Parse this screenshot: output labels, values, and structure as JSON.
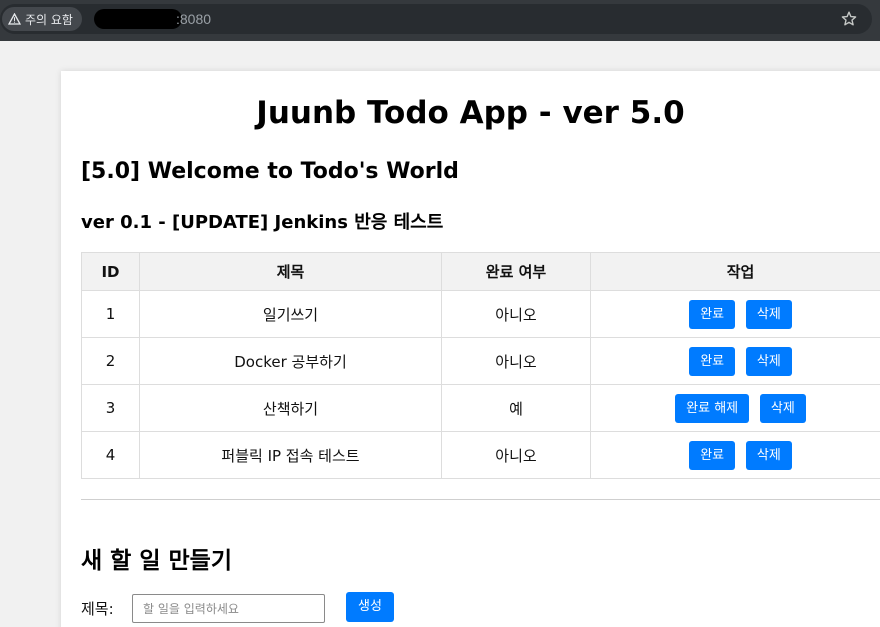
{
  "browser": {
    "security_label": "주의 요함",
    "url_visible": ":8080"
  },
  "page": {
    "app_title": "Juunb Todo App - ver 5.0",
    "welcome": "[5.0] Welcome to Todo's World",
    "version_note": "ver 0.1 - [UPDATE] Jenkins 반응 테스트"
  },
  "table": {
    "headers": [
      "ID",
      "제목",
      "완료 여부",
      "작업"
    ],
    "rows": [
      {
        "id": "1",
        "title": "일기쓰기",
        "done": "아니오",
        "toggle": "완료",
        "delete": "삭제"
      },
      {
        "id": "2",
        "title": "Docker 공부하기",
        "done": "아니오",
        "toggle": "완료",
        "delete": "삭제"
      },
      {
        "id": "3",
        "title": "산책하기",
        "done": "예",
        "toggle": "완료 해제",
        "delete": "삭제"
      },
      {
        "id": "4",
        "title": "퍼블릭 IP 접속 테스트",
        "done": "아니오",
        "toggle": "완료",
        "delete": "삭제"
      }
    ]
  },
  "form": {
    "heading": "새 할 일 만들기",
    "title_label": "제목:",
    "title_placeholder": "할 일을 입력하세요",
    "title_value": "",
    "create_label": "생성"
  },
  "colors": {
    "button": "#007bff",
    "header_bg": "#f2f2f2",
    "chrome_bg": "#35393d"
  }
}
